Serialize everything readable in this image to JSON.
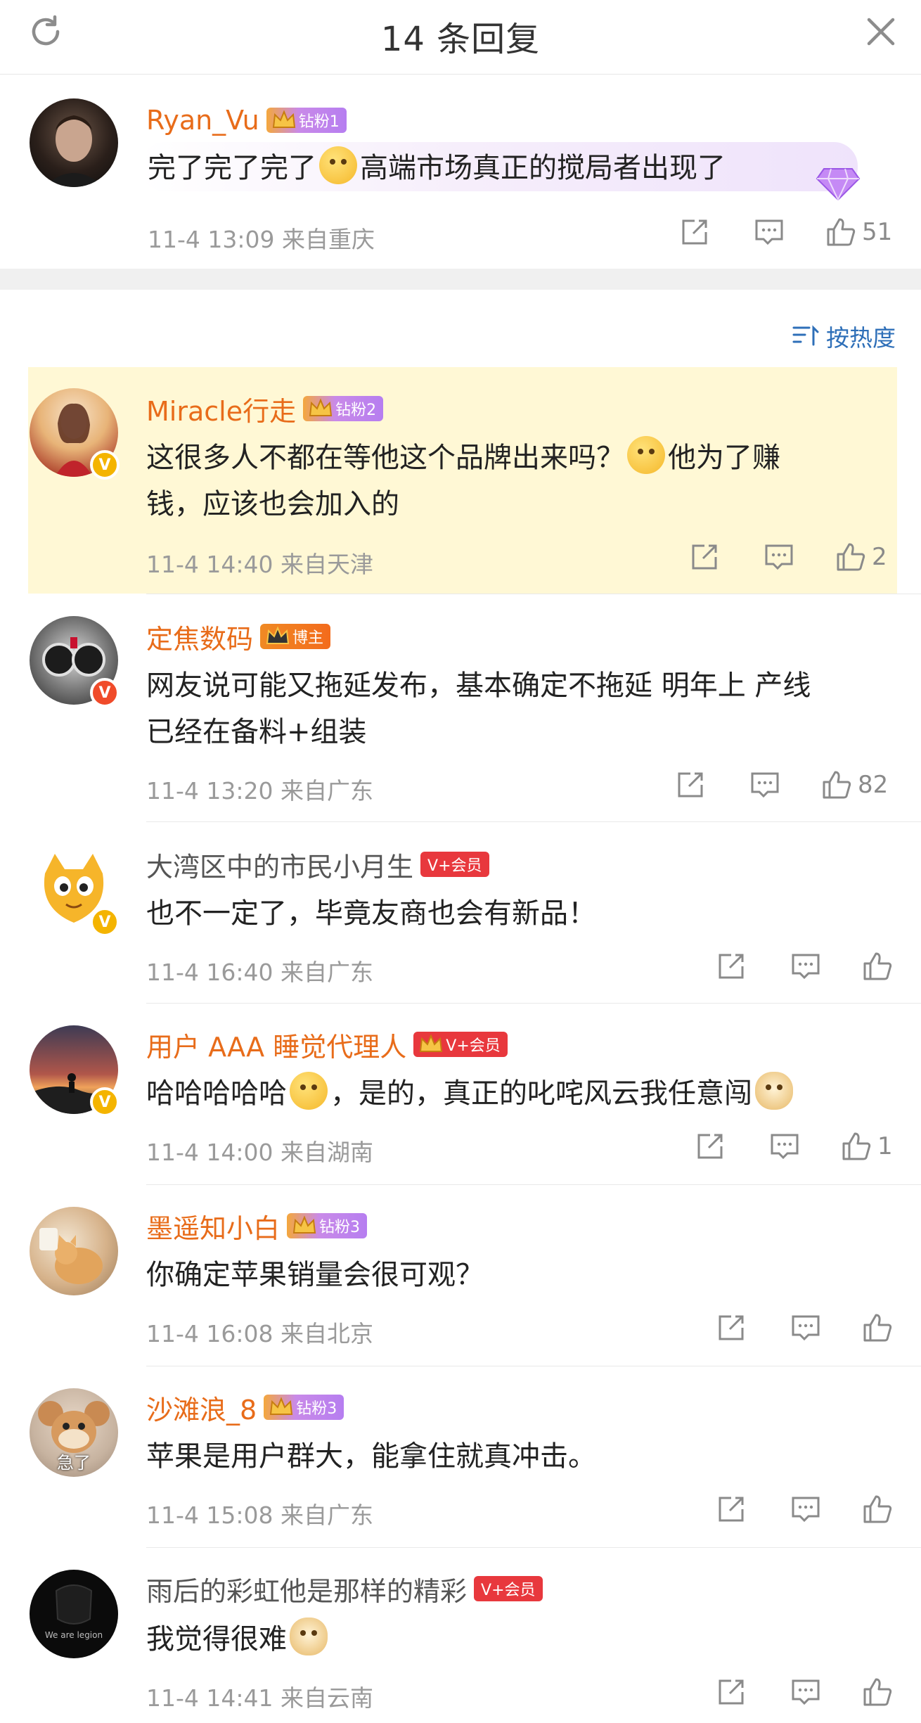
{
  "header": {
    "title": "14 条回复"
  },
  "root": {
    "name": "Ryan_Vu",
    "tag": "钻粉1",
    "text_a": "完了完了完了",
    "text_b": "高端市场真正的搅局者出现了",
    "meta": "11-4 13:09  来自重庆",
    "likes": "51"
  },
  "sort": {
    "label": "按热度"
  },
  "replies": [
    {
      "name": "Miracle行走",
      "tag": "钻粉2",
      "line1_a": "这很多人不都在等他这个品牌出来吗？",
      "line1_b": "他为了赚",
      "line2": "钱，应该也会加入的",
      "meta": "11-4 14:40  来自天津",
      "likes": "2"
    },
    {
      "name": "定焦数码",
      "tag": "博主",
      "line1": "网友说可能又拖延发布，基本确定不拖延 明年上 产线",
      "line2": "已经在备料+组装",
      "meta": "11-4 13:20  来自广东",
      "likes": "82"
    },
    {
      "name": "大湾区中的市民小月生",
      "tag": "V+会员",
      "line1": "也不一定了，毕竟友商也会有新品！",
      "meta": "11-4 16:40  来自广东",
      "likes": ""
    },
    {
      "name": "用户 AAA 睡觉代理人",
      "tag": "V+会员",
      "line1_a": "哈哈哈哈哈",
      "line1_b": "，是的，真正的叱咤风云我任意闯",
      "meta": "11-4 14:00  来自湖南",
      "likes": "1"
    },
    {
      "name": "墨遥知小白",
      "tag": "钻粉3",
      "line1": "你确定苹果销量会很可观？",
      "meta": "11-4 16:08  来自北京",
      "likes": ""
    },
    {
      "name": "沙滩浪_8",
      "tag": "钻粉3",
      "avatar_text": "急了",
      "line1": "苹果是用户群大，能拿住就真冲击。",
      "meta": "11-4 15:08  来自广东",
      "likes": ""
    },
    {
      "name": "雨后的彩虹他是那样的精彩",
      "tag": "V+会员",
      "avatar_text": "We are legion",
      "line1": "我觉得很难",
      "meta": "11-4 14:41  来自云南",
      "likes": ""
    }
  ],
  "colors": {
    "name_orange": "#e86c1a",
    "link_blue": "#2e6fb8",
    "highlight": "#fff8d5",
    "vip_red": "#e8383d"
  }
}
